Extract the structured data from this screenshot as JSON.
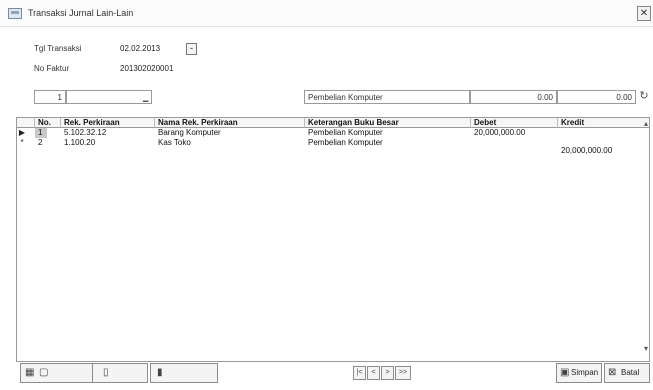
{
  "window": {
    "title": "Transaksi Jurnal Lain-Lain",
    "close_glyph": "✕",
    "icon": "app-window-icon"
  },
  "header": {
    "tgl_label": "Tgl Transaksi",
    "tgl_value": "02.02.2013",
    "faktur_label": "No Faktur",
    "faktur_value": "201302020001"
  },
  "entry": {
    "field1": "1",
    "field2": "",
    "keterangan": "Pembelian Komputer",
    "debet": "0.00",
    "kredit": "0.00"
  },
  "grid": {
    "columns": [
      "No.",
      "Rek. Perkiraan",
      "Nama Rek. Perkiraan",
      "Keterangan Buku Besar",
      "Debet",
      "Kredit"
    ],
    "rows": [
      {
        "no": "1",
        "rek": "5.102.32.12",
        "nama": "Barang Komputer",
        "ket": "Pembelian Komputer",
        "debet": "20,000,000.00",
        "kredit": ""
      },
      {
        "no": "2",
        "rek": "1.100.20",
        "nama": "Kas Toko",
        "ket": "Pembelian Komputer",
        "debet": "",
        "kredit": "20,000,000.00"
      }
    ]
  },
  "toolbar": {
    "nav_first": "|<",
    "nav_prev": "<",
    "nav_next": ">",
    "nav_last": ">>",
    "save_label": "Simpan",
    "exit_label": "Batal"
  }
}
